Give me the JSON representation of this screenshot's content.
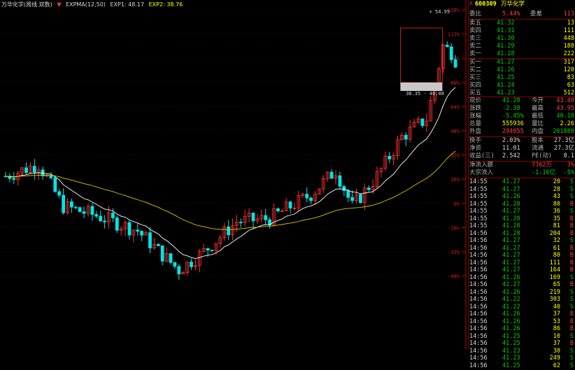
{
  "header": {
    "stock_label": "万华化学(周线 双数)",
    "indicator_name": "EXPMA(12,50)",
    "exp1_label": "EXP1: 48.17",
    "exp2_label": "EXP2: 38.76"
  },
  "colors": {
    "up": "#ff3030",
    "down": "#00e5e5",
    "exp1": "#ffffff",
    "exp2": "#d8c800",
    "grid": "#7a0000",
    "axis": "#c00000"
  },
  "chart_data": {
    "type": "candlestick",
    "y_axis_labels": [
      "128%",
      "112%",
      "96%",
      "80%",
      "64%",
      "48%",
      "32%",
      "16%",
      "0%",
      "-16%",
      "-32%",
      "-48%"
    ],
    "high_annotation": "54.95",
    "range_annotation": "38.35 - 40.08"
  },
  "panel": {
    "code": "600309",
    "name": "万华化学",
    "webi_label": "委比",
    "webi_value": "5.44%",
    "weicha_label": "委差",
    "weicha_value": "113",
    "sells": [
      {
        "label": "卖五",
        "price": "41.32",
        "vol": "13"
      },
      {
        "label": "卖四",
        "price": "41.31",
        "vol": "111"
      },
      {
        "label": "卖三",
        "price": "41.30",
        "vol": "448"
      },
      {
        "label": "卖二",
        "price": "41.29",
        "vol": "188"
      },
      {
        "label": "卖一",
        "price": "41.28",
        "vol": "222"
      }
    ],
    "buys": [
      {
        "label": "买一",
        "price": "41.27",
        "vol": "317"
      },
      {
        "label": "买二",
        "price": "41.26",
        "vol": "120"
      },
      {
        "label": "买三",
        "price": "41.25",
        "vol": "83"
      },
      {
        "label": "买四",
        "price": "41.24",
        "vol": "63"
      },
      {
        "label": "买五",
        "price": "41.23",
        "vol": "512"
      }
    ],
    "quotes": [
      {
        "l1": "现价",
        "v1": "41.28",
        "l2": "今开",
        "v2": "43.40"
      },
      {
        "l1": "涨跌",
        "v1": "-2.38",
        "l2": "最高",
        "v2": "43.95"
      },
      {
        "l1": "涨幅",
        "v1": "-5.45%",
        "l2": "最低",
        "v2": "40.10"
      },
      {
        "l1": "总量",
        "v1": "555936",
        "l2": "量比",
        "v2": "2.26"
      },
      {
        "l1": "外盘",
        "v1": "294055",
        "l2": "内盘",
        "v2": "261880"
      }
    ],
    "fundamentals": [
      {
        "l1": "换手",
        "v1": "2.03%",
        "l2": "股本",
        "v2": "27.3亿"
      },
      {
        "l1": "净资",
        "v1": "11.01",
        "l2": "流通",
        "v2": "27.3亿"
      },
      {
        "l1": "收益(三)",
        "v1": "2.542",
        "l2": "PE(动)",
        "v2": "8.1"
      }
    ],
    "flows": [
      {
        "label": "净流入额",
        "value": "7362万",
        "pct": "3%"
      },
      {
        "label": "大宗流入",
        "value": "-1.16亿",
        "pct": "-5%"
      }
    ],
    "ticks": [
      {
        "t": "14:55",
        "p": "41.27",
        "v": "20",
        "d": "S"
      },
      {
        "t": "14:55",
        "p": "41.27",
        "v": "28",
        "d": "S"
      },
      {
        "t": "14:55",
        "p": "41.26",
        "v": "43",
        "d": "S"
      },
      {
        "t": "14:55",
        "p": "41.28",
        "v": "80",
        "d": "B"
      },
      {
        "t": "14:55",
        "p": "41.27",
        "v": "36",
        "d": "S"
      },
      {
        "t": "14:55",
        "p": "41.28",
        "v": "35",
        "d": "B"
      },
      {
        "t": "14:55",
        "p": "41.28",
        "v": "81",
        "d": "B"
      },
      {
        "t": "14:56",
        "p": "41.28",
        "v": "204",
        "d": "B"
      },
      {
        "t": "14:56",
        "p": "41.27",
        "v": "32",
        "d": "S"
      },
      {
        "t": "14:56",
        "p": "41.27",
        "v": "61",
        "d": "B"
      },
      {
        "t": "14:56",
        "p": "41.27",
        "v": "80",
        "d": "B"
      },
      {
        "t": "14:56",
        "p": "41.27",
        "v": "111",
        "d": "B"
      },
      {
        "t": "14:56",
        "p": "41.27",
        "v": "164",
        "d": "B"
      },
      {
        "t": "14:56",
        "p": "41.26",
        "v": "169",
        "d": "S"
      },
      {
        "t": "14:56",
        "p": "41.27",
        "v": "65",
        "d": "B"
      },
      {
        "t": "14:56",
        "p": "41.26",
        "v": "219",
        "d": "S"
      },
      {
        "t": "14:56",
        "p": "41.22",
        "v": "303",
        "d": "S"
      },
      {
        "t": "14:56",
        "p": "41.22",
        "v": "40",
        "d": "S"
      },
      {
        "t": "14:56",
        "p": "41.26",
        "v": "37",
        "d": "B"
      },
      {
        "t": "14:56",
        "p": "41.26",
        "v": "53",
        "d": "B"
      },
      {
        "t": "14:56",
        "p": "41.26",
        "v": "86",
        "d": "B"
      },
      {
        "t": "14:56",
        "p": "41.25",
        "v": "10",
        "d": "S"
      },
      {
        "t": "14:56",
        "p": "41.25",
        "v": "37",
        "d": "B"
      },
      {
        "t": "14:56",
        "p": "41.23",
        "v": "30",
        "d": "S"
      },
      {
        "t": "14:56",
        "p": "41.23",
        "v": "249",
        "d": "S"
      },
      {
        "t": "14:56",
        "p": "41.25",
        "v": "62",
        "d": "S"
      }
    ]
  }
}
